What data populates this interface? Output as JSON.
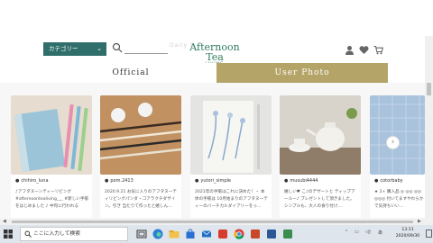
{
  "header": {
    "category_label": "カテゴリー",
    "ghost_text": "Daily  S              ",
    "logo_main": "Afternoon Tea",
    "logo_sub": "LIVING"
  },
  "tabs": [
    {
      "label": "Official"
    },
    {
      "label": "User Photo"
    }
  ],
  "cards": [
    {
      "user": "chihiro_luna",
      "caption": "♪アフタヌーンティーリビング #afternoontealiving___ #新しい手帳をはじめました ♪ 中旬に行われる○○… ♪(¯ω¯) 試 ♪ たまの生し使い…"
    },
    {
      "user": "pom.2413",
      "caption": "2020.9.21 お気に入りのアフタヌーティリビングパンダ・コアラクチダザイン。引き 当たりて作ったと嬉しん…"
    },
    {
      "user": "yutori_simple",
      "caption": "2021年の手帳はこれに決めた！・ 本体の手帳は 10月始まりのアフタヌーティーのバーチカルダイアリーをっ…"
    },
    {
      "user": "musubi4444",
      "caption": "嬉しい♥ こ♪のデザートと ティップアールー♪ プレゼントして頂きました。シンプルも、大人の食り付け…"
    },
    {
      "user": "cotorbaby",
      "caption": "★ 2+ 購入品 ◎ ◎◎ ◎◎ ◎◎◎ 付いてますやわらかで気持ちいい… #afternoon"
    }
  ],
  "taskbar": {
    "search_placeholder": "ここに入力して検索",
    "tray_lang": "あ",
    "time": "13:11",
    "date": "2020/09/30"
  },
  "colors": {
    "accent_green": "#2f6e6a",
    "logo_green": "#2e7a5c",
    "tab_gold": "#b5a468"
  }
}
